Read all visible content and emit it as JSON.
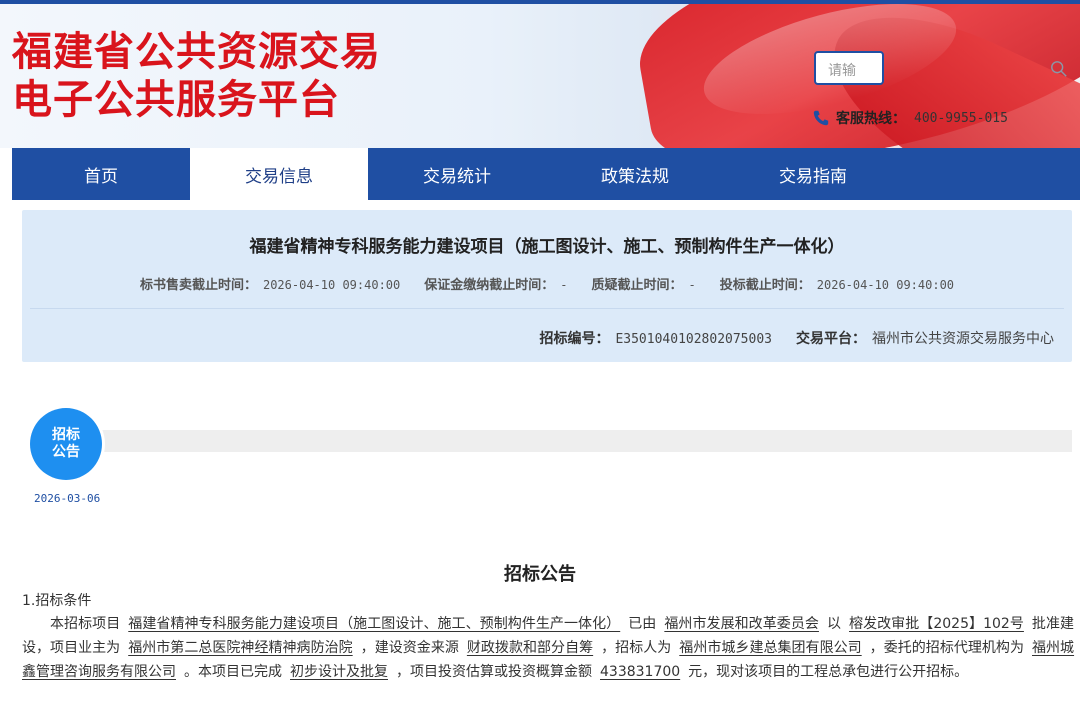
{
  "header": {
    "logo_line1": "福建省公共资源交易",
    "logo_line2": "电子公共服务平台",
    "search_placeholder": "请输",
    "hotline_label": "客服热线：",
    "hotline_value": "400-9955-015"
  },
  "nav": {
    "items": [
      {
        "label": "首页",
        "active": false
      },
      {
        "label": "交易信息",
        "active": true
      },
      {
        "label": "交易统计",
        "active": false
      },
      {
        "label": "政策法规",
        "active": false
      },
      {
        "label": "交易指南",
        "active": false
      }
    ]
  },
  "project": {
    "title": "福建省精神专科服务能力建设项目（施工图设计、施工、预制构件生产一体化）",
    "deadlines": [
      {
        "label": "标书售卖截止时间：",
        "value": "2026-04-10 09:40:00"
      },
      {
        "label": "保证金缴纳截止时间：",
        "value": "-"
      },
      {
        "label": "质疑截止时间：",
        "value": "-"
      },
      {
        "label": "投标截止时间：",
        "value": "2026-04-10 09:40:00"
      }
    ],
    "bid_no_label": "招标编号：",
    "bid_no_value": "E3501040102802075003",
    "platform_label": "交易平台：",
    "platform_value": "福州市公共资源交易服务中心"
  },
  "timeline": {
    "stage_line1": "招标",
    "stage_line2": "公告",
    "stage_date": "2026-03-06"
  },
  "announcement": {
    "title": "招标公告",
    "section1": "1.招标条件",
    "p1": "本招标项目",
    "project_name": "福建省精神专科服务能力建设项目（施工图设计、施工、预制构件生产一体化）",
    "p2": "已由",
    "approver": "福州市发展和改革委员会",
    "p3": "以",
    "approval_no": "榕发改审批【2025】102号",
    "p4": "批准建设，项目业主为",
    "owner": "福州市第二总医院神经精神病防治院",
    "p5": "，建设资金来源",
    "fund_source": "财政拨款和部分自筹",
    "p6": "，招标人为",
    "tenderer": "福州市城乡建总集团有限公司",
    "p7": "，委托的招标代理机构为",
    "agency": "福州城鑫管理咨询服务有限公司",
    "p8": "。本项目已完成",
    "stage_done": "初步设计及批复",
    "p9": "，项目投资估算或投资概算金额",
    "amount": "433831700",
    "p10": "元，现对该项目的工程总承包进行公开招标。"
  },
  "colors": {
    "brand_blue": "#1f4fa3",
    "logo_red": "#d9141c",
    "panel_bg": "#dceaf9",
    "stage_blue": "#1e8ff0"
  }
}
